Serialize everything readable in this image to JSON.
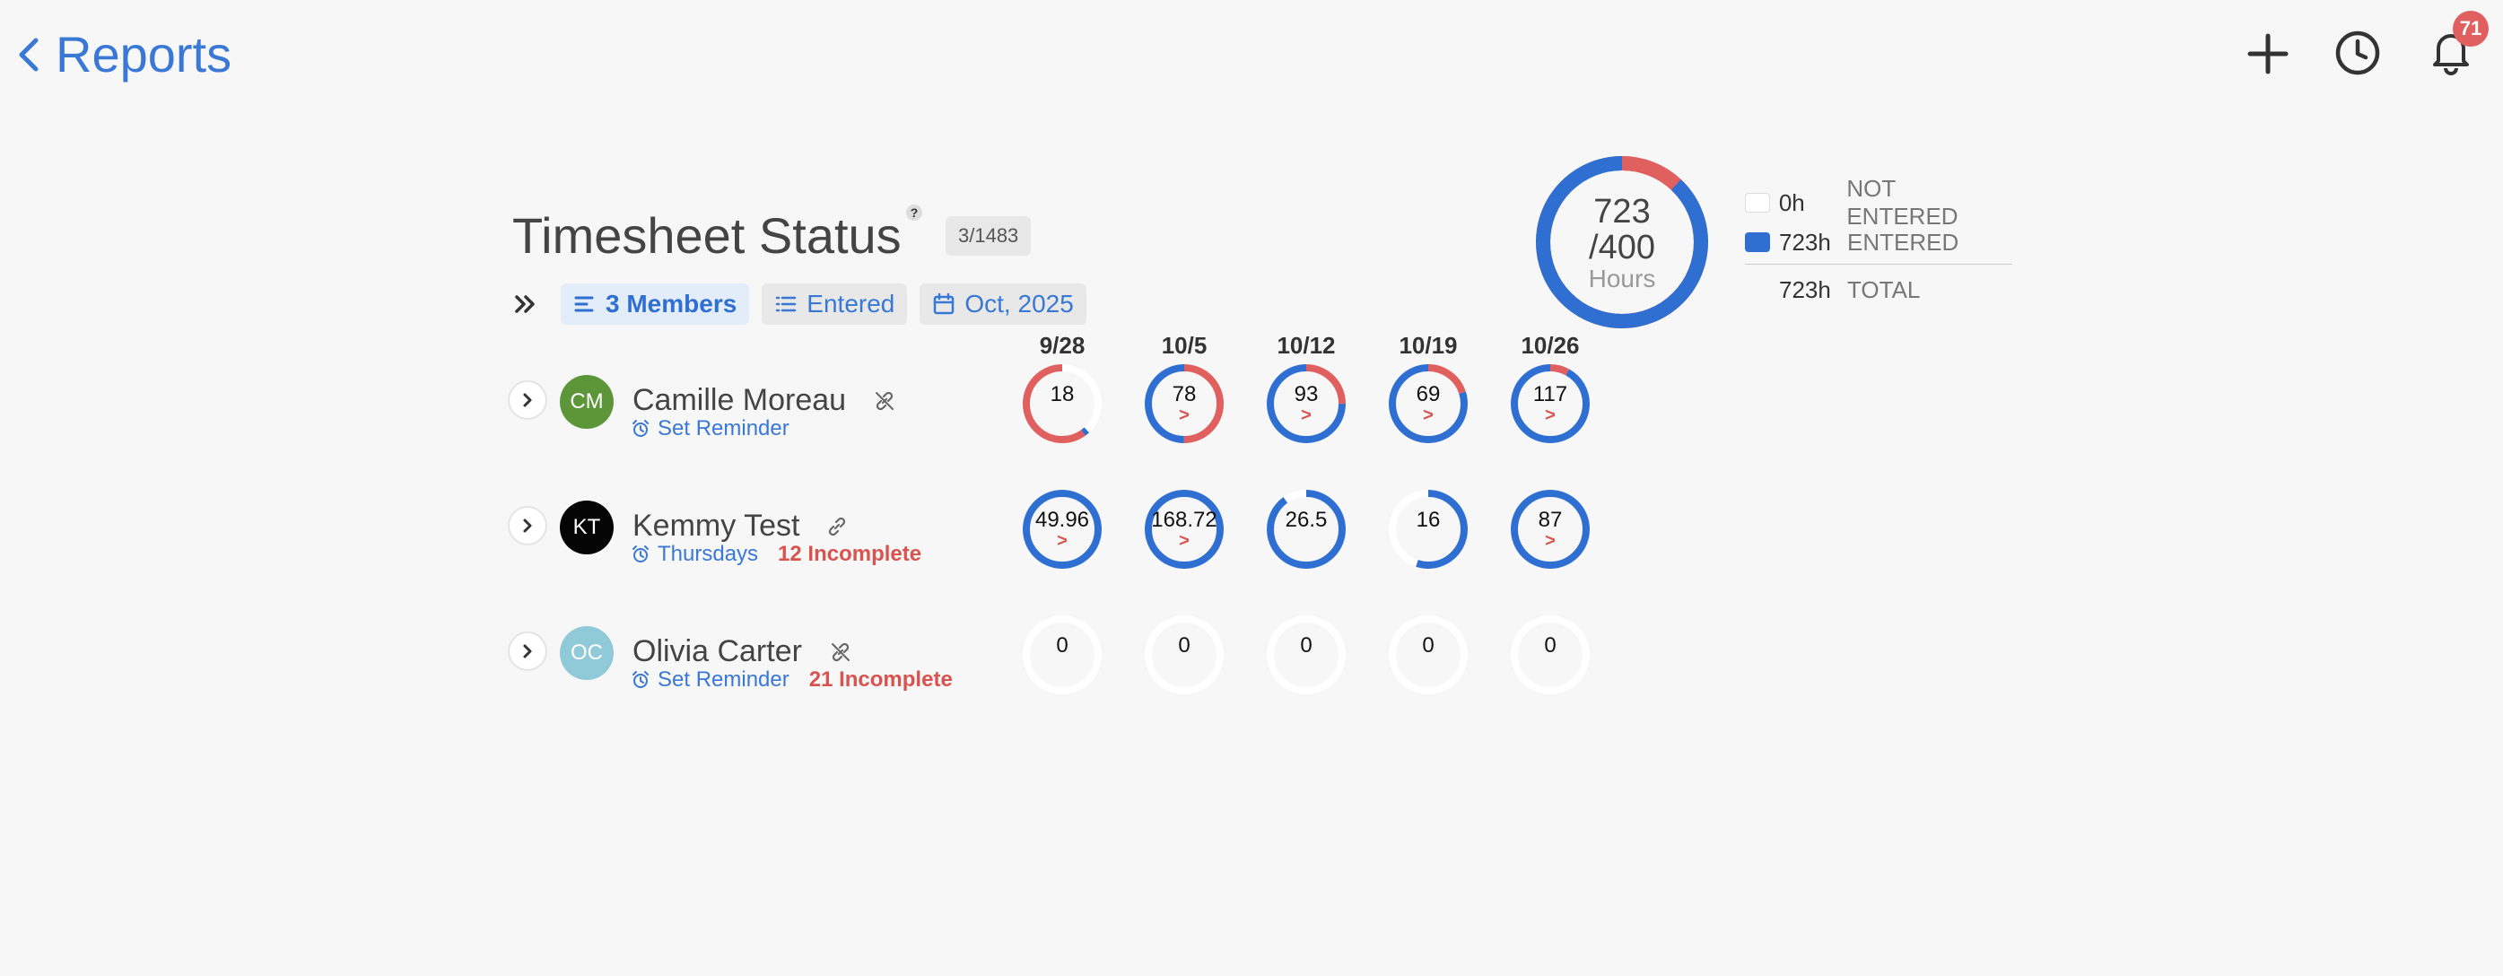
{
  "nav": {
    "back_label": "Reports"
  },
  "header_actions": {
    "notification_count": "71"
  },
  "page": {
    "title": "Timesheet Status",
    "help": "?",
    "count_chip": "3/1483"
  },
  "filters": {
    "members": "3 Members",
    "status": "Entered",
    "period": "Oct, 2025"
  },
  "summary": {
    "main": "723",
    "target": "/400",
    "unit": "Hours",
    "entered_fraction": 0.88,
    "legend": [
      {
        "value": "0h",
        "label": "NOT ENTERED"
      },
      {
        "value": "723h",
        "label": "ENTERED"
      },
      {
        "value": "723h",
        "label": "TOTAL"
      }
    ]
  },
  "weeks": [
    "9/28",
    "10/5",
    "10/12",
    "10/19",
    "10/26"
  ],
  "colors": {
    "accent": "#2f6fd1",
    "warning": "#e05f5f",
    "track": "#ffffff"
  },
  "members": [
    {
      "initials": "CM",
      "name": "Camille Moreau",
      "avatar_color": "#5d9639",
      "reminder": "Set Reminder",
      "incomplete": "",
      "cells": [
        {
          "value": "18",
          "flag": "",
          "blue": 0.02,
          "red": 0.6,
          "gap_start": 0.02
        },
        {
          "value": "78",
          "flag": ">",
          "blue": 0.5,
          "red": 0.5
        },
        {
          "value": "93",
          "flag": ">",
          "blue": 0.75,
          "red": 0.25
        },
        {
          "value": "69",
          "flag": ">",
          "blue": 0.8,
          "red": 0.2
        },
        {
          "value": "117",
          "flag": ">",
          "blue": 0.92,
          "red": 0.08
        }
      ]
    },
    {
      "initials": "KT",
      "name": "Kemmy Test",
      "avatar_color": "#050505",
      "reminder": "Thursdays",
      "incomplete": "12 Incomplete",
      "cells": [
        {
          "value": "49.96",
          "flag": ">",
          "blue": 1.0,
          "red": 0.0
        },
        {
          "value": "168.72",
          "flag": ">",
          "blue": 1.0,
          "red": 0.0
        },
        {
          "value": "26.5",
          "flag": "",
          "blue": 0.9,
          "red": 0.0
        },
        {
          "value": "16",
          "flag": "",
          "blue": 0.55,
          "red": 0.0
        },
        {
          "value": "87",
          "flag": ">",
          "blue": 1.0,
          "red": 0.0
        }
      ]
    },
    {
      "initials": "OC",
      "name": "Olivia Carter",
      "avatar_color": "#90c9d8",
      "reminder": "Set Reminder",
      "incomplete": "21 Incomplete",
      "cells": [
        {
          "value": "0",
          "flag": "",
          "blue": 0,
          "red": 0
        },
        {
          "value": "0",
          "flag": "",
          "blue": 0,
          "red": 0
        },
        {
          "value": "0",
          "flag": "",
          "blue": 0,
          "red": 0
        },
        {
          "value": "0",
          "flag": "",
          "blue": 0,
          "red": 0
        },
        {
          "value": "0",
          "flag": "",
          "blue": 0,
          "red": 0
        }
      ]
    }
  ]
}
